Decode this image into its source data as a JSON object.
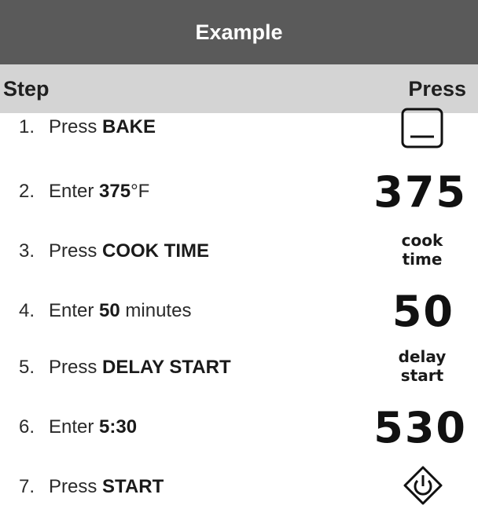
{
  "title": "Example",
  "header": {
    "step": "Step",
    "press": "Press"
  },
  "steps": [
    {
      "num": "1.",
      "pre": "Press ",
      "bold": "BAKE",
      "post": "",
      "key": {
        "icon": "bake-key-icon"
      }
    },
    {
      "num": "2.",
      "pre": "Enter ",
      "bold": "375",
      "post": "°F",
      "key": {
        "text": "375"
      }
    },
    {
      "num": "3.",
      "pre": "Press ",
      "bold": "COOK TIME",
      "post": "",
      "key": {
        "line1": "cook",
        "line2": "time"
      }
    },
    {
      "num": "4.",
      "pre": "Enter ",
      "bold": "50",
      "post": " minutes",
      "key": {
        "text": "50"
      }
    },
    {
      "num": "5.",
      "pre": "Press ",
      "bold": "DELAY START",
      "post": "",
      "key": {
        "line1": "delay",
        "line2": "start"
      }
    },
    {
      "num": "6.",
      "pre": "Enter ",
      "bold": "5:30",
      "post": "",
      "key": {
        "text": "530"
      }
    },
    {
      "num": "7.",
      "pre": "Press ",
      "bold": "START",
      "post": "",
      "key": {
        "icon": "start-key-icon"
      }
    }
  ]
}
